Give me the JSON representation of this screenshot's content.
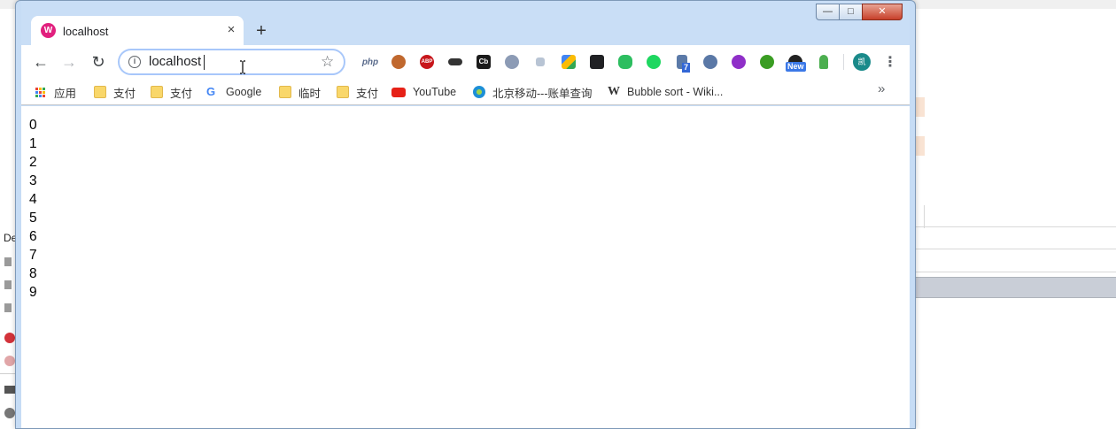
{
  "background_app": {
    "left_text": "De"
  },
  "window": {
    "controls": {
      "minimize": "—",
      "maximize": "□",
      "close": "✕"
    }
  },
  "tab": {
    "title": "localhost",
    "close": "×"
  },
  "newtab": "+",
  "toolbar": {
    "back": "←",
    "forward": "→",
    "reload": "↻",
    "url": "localhost",
    "info": "i",
    "star": "☆",
    "extensions": [
      {
        "name": "php-extension-icon",
        "label": "php"
      },
      {
        "name": "tampermonkey-icon",
        "color": "#c0682e"
      },
      {
        "name": "adblock-plus-icon",
        "label": "ABP",
        "color": "#c7161b"
      },
      {
        "name": "mask-extension-icon",
        "color": "#333333"
      },
      {
        "name": "cb-extension-icon",
        "label": "Cb",
        "color": "#1b1b1b"
      },
      {
        "name": "gear-extension-icon",
        "color": "#8c9bb5"
      },
      {
        "name": "network-extension-icon",
        "color": "#b8c4d4"
      },
      {
        "name": "google-drive-extension-icon",
        "color": "#4285f4"
      },
      {
        "name": "tab-extension-icon",
        "color": "#202124"
      },
      {
        "name": "evernote-icon",
        "color": "#2dbe60"
      },
      {
        "name": "spotify-icon",
        "color": "#1ed760"
      },
      {
        "name": "list-extension-icon",
        "color": "#5b7aa8",
        "badge": "7"
      },
      {
        "name": "globe-extension-icon",
        "color": "#5a78a6"
      },
      {
        "name": "code-extension-icon",
        "color": "#8f2fc8"
      },
      {
        "name": "bug-extension-icon",
        "color": "#3a9d23"
      },
      {
        "name": "speed-extension-icon",
        "color": "#222222",
        "badge": "New"
      },
      {
        "name": "android-extension-icon",
        "color": "#4caf50"
      }
    ],
    "avatar_text": "凯",
    "menu": "⋮"
  },
  "bookmarks": {
    "items": [
      {
        "label": "应用",
        "type": "apps"
      },
      {
        "label": "支付",
        "type": "folder"
      },
      {
        "label": "支付",
        "type": "folder"
      },
      {
        "label": "Google",
        "type": "google"
      },
      {
        "label": "临时",
        "type": "folder"
      },
      {
        "label": "支付",
        "type": "folder"
      },
      {
        "label": "YouTube",
        "type": "youtube"
      },
      {
        "label": "北京移动---账单查询",
        "type": "site"
      },
      {
        "label": "Bubble sort - Wiki...",
        "type": "wiki"
      }
    ],
    "more": "»"
  },
  "page": {
    "lines": [
      "0",
      "1",
      "2",
      "3",
      "4",
      "5",
      "6",
      "7",
      "8",
      "9"
    ]
  },
  "colors": {
    "titlebar": "#c9def6",
    "favicon": "#e1207e",
    "omnibox_focus": "#a8c7fa"
  }
}
